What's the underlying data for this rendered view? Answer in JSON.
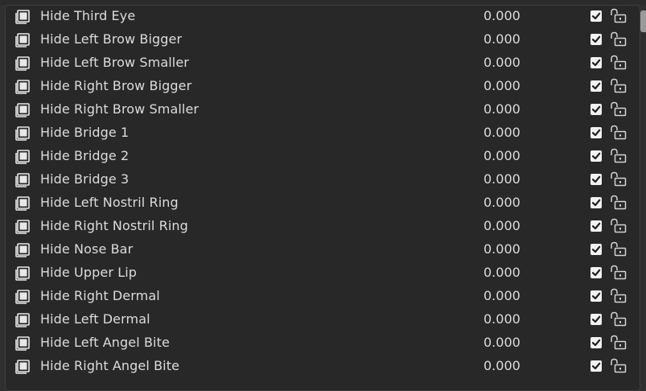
{
  "rows": [
    {
      "name": "Hide Third Eye",
      "value": "0.000",
      "checked": true
    },
    {
      "name": "Hide Left Brow Bigger",
      "value": "0.000",
      "checked": true
    },
    {
      "name": "Hide Left Brow Smaller",
      "value": "0.000",
      "checked": true
    },
    {
      "name": "Hide Right Brow Bigger",
      "value": "0.000",
      "checked": true
    },
    {
      "name": "Hide Right Brow Smaller",
      "value": "0.000",
      "checked": true
    },
    {
      "name": "Hide Bridge 1",
      "value": "0.000",
      "checked": true
    },
    {
      "name": "Hide Bridge 2",
      "value": "0.000",
      "checked": true
    },
    {
      "name": "Hide Bridge 3",
      "value": "0.000",
      "checked": true
    },
    {
      "name": "Hide Left Nostril Ring",
      "value": "0.000",
      "checked": true
    },
    {
      "name": "Hide Right Nostril Ring",
      "value": "0.000",
      "checked": true
    },
    {
      "name": "Hide Nose Bar",
      "value": "0.000",
      "checked": true
    },
    {
      "name": "Hide Upper Lip",
      "value": "0.000",
      "checked": true
    },
    {
      "name": "Hide Right Dermal",
      "value": "0.000",
      "checked": true
    },
    {
      "name": "Hide Left Dermal",
      "value": "0.000",
      "checked": true
    },
    {
      "name": "Hide Left Angel Bite",
      "value": "0.000",
      "checked": true
    },
    {
      "name": "Hide Right Angel Bite",
      "value": "0.000",
      "checked": true
    }
  ],
  "icons": {
    "row_icon": "shape-key-icon",
    "check_icon": "checkbox-checked-icon",
    "lock_icon": "unlocked-padlock-icon"
  },
  "colors": {
    "background": "#282828",
    "text": "#dcdcdc",
    "checkbox": "#f2f2f2",
    "scrollbar": "#9a9a9a"
  }
}
